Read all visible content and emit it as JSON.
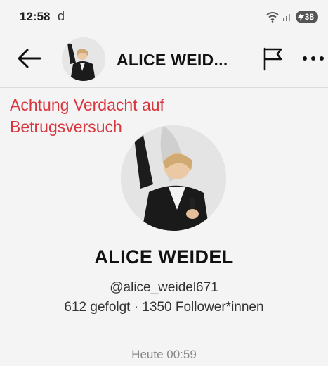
{
  "status_bar": {
    "time": "12:58",
    "app_glyph": "d",
    "battery_level": "38",
    "icons": [
      "wifi-icon",
      "signal-icon",
      "battery-charging-icon"
    ]
  },
  "header": {
    "title": "ALICE WEID...",
    "back_icon": "arrow-left-icon",
    "flag_icon": "flag-icon",
    "more_icon": "more-dots-icon"
  },
  "warning_text": "Achtung Verdacht auf Betrugsversuch",
  "profile": {
    "name": "ALICE WEIDEL",
    "handle": "@alice_weidel671",
    "stats": "612 gefolgt · 1350 Follower*innen"
  },
  "timestamp": "Heute 00:59",
  "colors": {
    "warning": "#d8373f",
    "background": "#f4f4f4",
    "text": "#111111",
    "muted": "#888888"
  }
}
